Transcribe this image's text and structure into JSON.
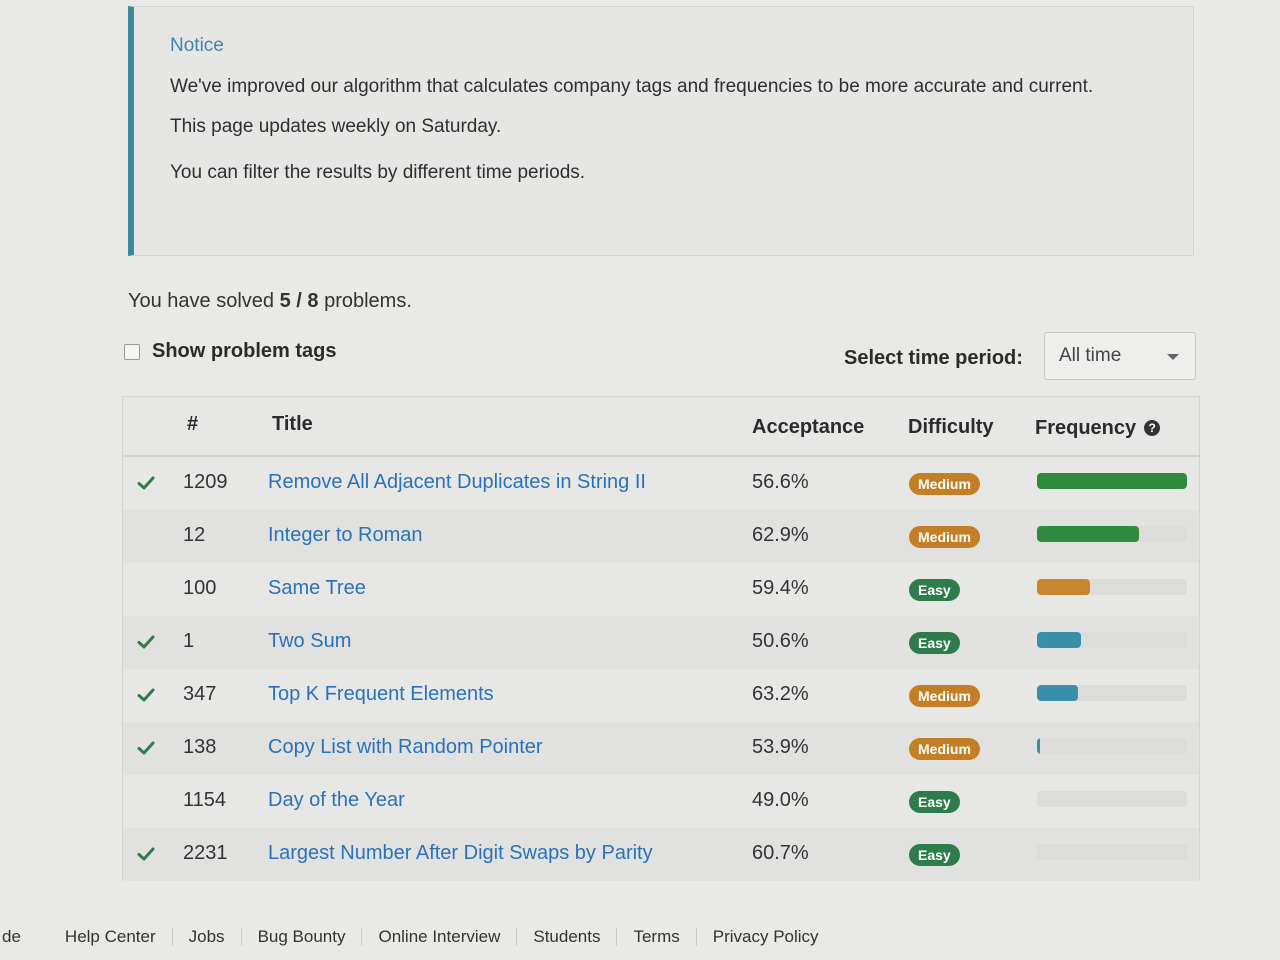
{
  "notice": {
    "title": "Notice",
    "line1": "We've improved our algorithm that calculates company tags and frequencies to be more accurate and current.",
    "line2": "This page updates weekly on Saturday.",
    "line3": "You can filter the results by different time periods."
  },
  "solved": {
    "prefix": "You have solved ",
    "count": "5 / 8",
    "suffix": " problems."
  },
  "tags_toggle": {
    "label": "Show problem tags",
    "checked": false
  },
  "period": {
    "label": "Select time period:",
    "selected": "All time"
  },
  "table": {
    "headers": {
      "num": "#",
      "title": "Title",
      "acceptance": "Acceptance",
      "difficulty": "Difficulty",
      "frequency": "Frequency"
    },
    "rows": [
      {
        "solved": true,
        "num": "1209",
        "title": "Remove All Adjacent Duplicates in String II",
        "acceptance": "56.6%",
        "difficulty": "Medium",
        "frequency": 1.0,
        "freq_color": "#2e8b3e"
      },
      {
        "solved": false,
        "num": "12",
        "title": "Integer to Roman",
        "acceptance": "62.9%",
        "difficulty": "Medium",
        "frequency": 0.68,
        "freq_color": "#2e8b3e"
      },
      {
        "solved": false,
        "num": "100",
        "title": "Same Tree",
        "acceptance": "59.4%",
        "difficulty": "Easy",
        "frequency": 0.35,
        "freq_color": "#c9862f"
      },
      {
        "solved": true,
        "num": "1",
        "title": "Two Sum",
        "acceptance": "50.6%",
        "difficulty": "Easy",
        "frequency": 0.29,
        "freq_color": "#3a8fa8"
      },
      {
        "solved": true,
        "num": "347",
        "title": "Top K Frequent Elements",
        "acceptance": "63.2%",
        "difficulty": "Medium",
        "frequency": 0.27,
        "freq_color": "#3a8fa8"
      },
      {
        "solved": true,
        "num": "138",
        "title": "Copy List with Random Pointer",
        "acceptance": "53.9%",
        "difficulty": "Medium",
        "frequency": 0.02,
        "freq_color": "#3a8fa8"
      },
      {
        "solved": false,
        "num": "1154",
        "title": "Day of the Year",
        "acceptance": "49.0%",
        "difficulty": "Easy",
        "frequency": 0.0,
        "freq_color": "#3a8fa8"
      },
      {
        "solved": true,
        "num": "2231",
        "title": "Largest Number After Digit Swaps by Parity",
        "acceptance": "60.7%",
        "difficulty": "Easy",
        "frequency": 0.0,
        "freq_color": "#3a8fa8"
      }
    ]
  },
  "footer": {
    "items": [
      "de",
      "Help Center",
      "Jobs",
      "Bug Bounty",
      "Online Interview",
      "Students",
      "Terms",
      "Privacy Policy"
    ]
  },
  "colors": {
    "link": "#2a72b8",
    "notice_accent": "#3e8a9c",
    "medium": "#c47f26",
    "easy": "#2e7c4c",
    "check": "#2e7c4c"
  },
  "icons": {
    "solved": "check-icon",
    "help": "question-circle-icon",
    "dropdown": "caret-down-icon"
  }
}
